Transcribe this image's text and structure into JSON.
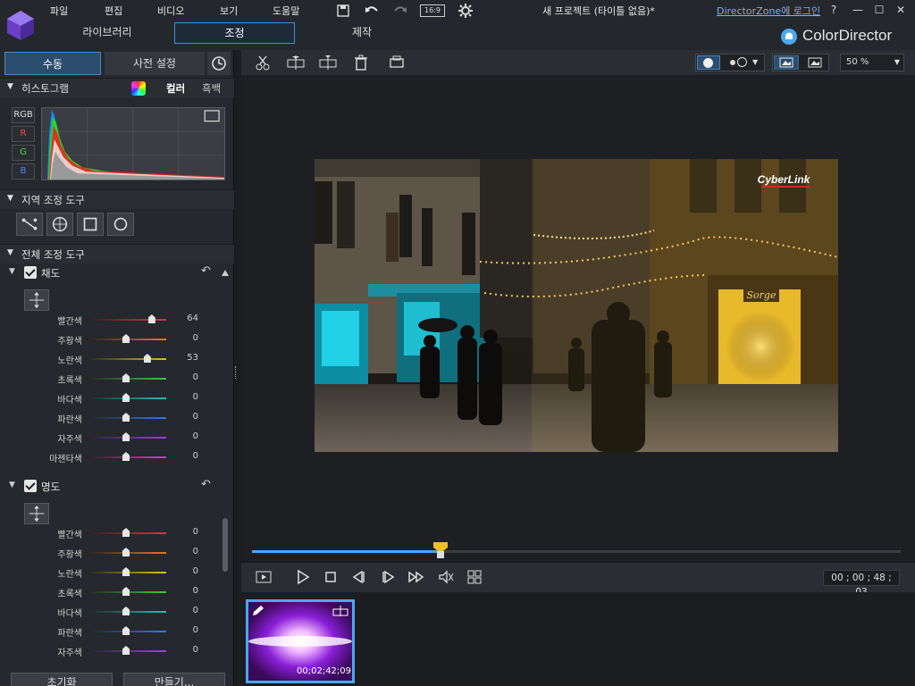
{
  "menu": [
    "파일",
    "편집",
    "비디오",
    "보기",
    "도움말"
  ],
  "aspect_label": "16:9",
  "project_title": "새 프로젝트 (타이틀 없음)*",
  "directorzone": "DirectorZone에 로그인",
  "help": "?",
  "main_tabs": [
    "라이브러리",
    "조정",
    "제작"
  ],
  "brand": "ColorDirector",
  "panel_tabs": {
    "manual": "수동",
    "preset": "사전 설정"
  },
  "histogram": {
    "title": "히스토그램",
    "color": "컬러",
    "mono": "흑백",
    "channels": [
      "RGB",
      "R",
      "G",
      "B"
    ]
  },
  "regional_tools": {
    "title": "지역 조정 도구"
  },
  "global_tools": {
    "title": "전체 조정 도구"
  },
  "saturation": {
    "title": "채도",
    "rows": [
      {
        "label": "빨간색",
        "value": 64
      },
      {
        "label": "주황색",
        "value": 0
      },
      {
        "label": "노란색",
        "value": 53
      },
      {
        "label": "초록색",
        "value": 0
      },
      {
        "label": "바다색",
        "value": 0
      },
      {
        "label": "파란색",
        "value": 0
      },
      {
        "label": "자주색",
        "value": 0
      },
      {
        "label": "마젠타색",
        "value": 0
      }
    ]
  },
  "brightness": {
    "title": "명도",
    "rows": [
      {
        "label": "빨간색",
        "value": 0
      },
      {
        "label": "주황색",
        "value": 0
      },
      {
        "label": "노란색",
        "value": 0
      },
      {
        "label": "초록색",
        "value": 0
      },
      {
        "label": "바다색",
        "value": 0
      },
      {
        "label": "파란색",
        "value": 0
      },
      {
        "label": "자주색",
        "value": 0
      }
    ]
  },
  "bottom_buttons": {
    "reset": "초기화",
    "create": "만들기..."
  },
  "zoom": "50 %",
  "preview_logo": "CyberLink",
  "shop_sign": "Sorge",
  "timecode": "00 ; 00 ; 48 ; 03",
  "playhead_fraction": 0.29,
  "thumb_timecode": "00;02;42;09",
  "colors": {
    "accent": "#4aa7f0",
    "panel": "#25282c",
    "canvas": "#1d1f22"
  }
}
